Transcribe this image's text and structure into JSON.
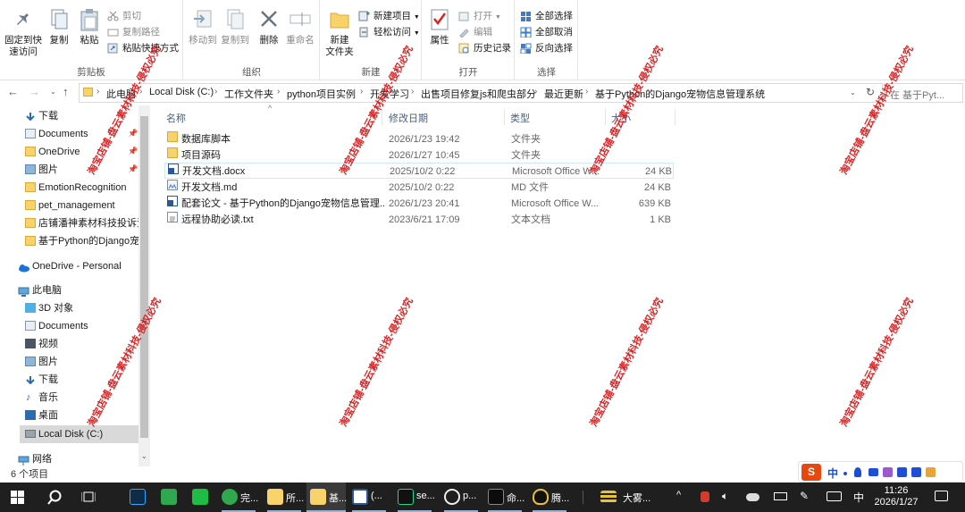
{
  "ribbon": {
    "clipboard_group": "剪贴板",
    "pin_quick": "固定到快\n速访问",
    "copy": "复制",
    "paste": "粘贴",
    "cut": "剪切",
    "copy_path": "复制路径",
    "paste_shortcut": "粘贴快捷方式",
    "organize_group": "组织",
    "move_to": "移动到",
    "copy_to": "复制到",
    "delete": "删除",
    "rename": "重命名",
    "new_group": "新建",
    "new_folder": "新建\n文件夹",
    "new_item": "新建项目",
    "easy_access": "轻松访问",
    "open_group": "打开",
    "properties": "属性",
    "open": "打开",
    "edit": "编辑",
    "history": "历史记录",
    "select_group": "选择",
    "select_all": "全部选择",
    "select_none": "全部取消",
    "invert_select": "反向选择"
  },
  "address": {
    "crumbs": [
      "此电脑",
      "Local Disk (C:)",
      "工作文件夹",
      "python项目实例",
      "开发学习",
      "出售项目修复js和爬虫部分",
      "最近更新",
      "基于Python的Django宠物信息管理系统"
    ],
    "search_placeholder": "在 基于Pyt..."
  },
  "nav": {
    "quick": [
      "下载",
      "Documents",
      "OneDrive",
      "图片",
      "EmotionRecognition",
      "pet_management",
      "店铺潘神素材科技投诉资",
      "基于Python的Django宠"
    ],
    "onedrive_personal": "OneDrive - Personal",
    "this_pc": "此电脑",
    "pc_items": [
      "3D 对象",
      "Documents",
      "视频",
      "图片",
      "下载",
      "音乐",
      "桌面",
      "Local Disk (C:)"
    ],
    "network": "网络"
  },
  "columns": {
    "name": "名称",
    "date": "修改日期",
    "type": "类型",
    "size": "大小"
  },
  "files": [
    {
      "name": "数据库脚本",
      "date": "2026/1/23 19:42",
      "type": "文件夹",
      "size": "",
      "icon": "folder-icon"
    },
    {
      "name": "项目源码",
      "date": "2026/1/27 10:45",
      "type": "文件夹",
      "size": "",
      "icon": "folder-icon"
    },
    {
      "name": "开发文档.docx",
      "date": "2025/10/2 0:22",
      "type": "Microsoft Office W...",
      "size": "24 KB",
      "icon": "word-doc-icon"
    },
    {
      "name": "开发文档.md",
      "date": "2025/10/2 0:22",
      "type": "MD 文件",
      "size": "24 KB",
      "icon": "markdown-file-icon"
    },
    {
      "name": "配套论文 - 基于Python的Django宠物信息管理...",
      "date": "2026/1/23 20:41",
      "type": "Microsoft Office W...",
      "size": "639 KB",
      "icon": "word-doc-icon"
    },
    {
      "name": "远程协助必读.txt",
      "date": "2023/6/21 17:09",
      "type": "文本文档",
      "size": "1 KB",
      "icon": "text-file-icon"
    }
  ],
  "status": {
    "item_count": "6 个项目"
  },
  "ime": {
    "lang": "中"
  },
  "taskbar": {
    "apps": [
      {
        "label": "完...",
        "icon": "browser-icon"
      },
      {
        "label": "所...",
        "icon": "folder-icon"
      },
      {
        "label": "基...",
        "icon": "folder-icon"
      },
      {
        "label": "(...",
        "icon": "word-icon"
      },
      {
        "label": "se...",
        "icon": "pycharm-icon"
      },
      {
        "label": "p...",
        "icon": "app-icon"
      },
      {
        "label": "命...",
        "icon": "terminal-icon"
      },
      {
        "label": "腾...",
        "icon": "qq-icon"
      },
      {
        "label": "大雾...",
        "icon": "weather-icon"
      }
    ],
    "lang": "中",
    "time": "11:26",
    "date": "2026/1/27"
  },
  "watermark": "淘宝店铺-盘云素材科技-侵权必究",
  "colors": {
    "accent": "#0078d7",
    "taskbar": "#1f1f1f",
    "watermark": "#d8191a",
    "folder": "#f8d26a"
  }
}
